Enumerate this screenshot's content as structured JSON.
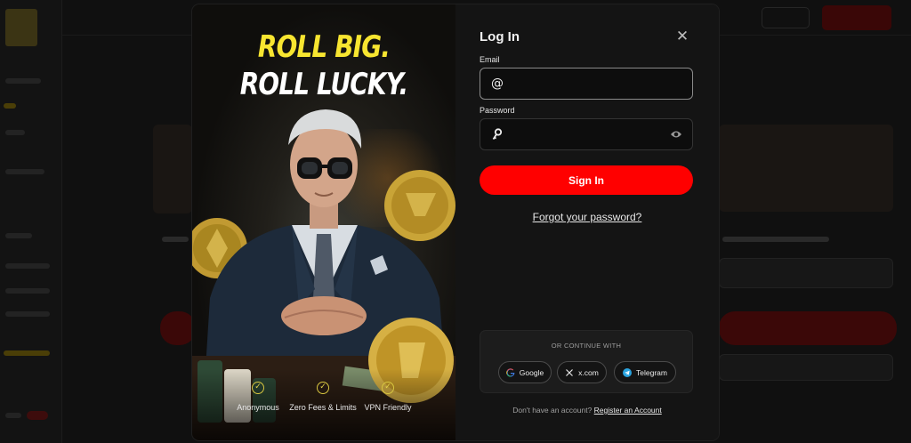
{
  "hero": {
    "headline_1": "ROLL BIG.",
    "headline_2": "ROLL LUCKY.",
    "perks": [
      {
        "label": "Anonymous"
      },
      {
        "label": "Zero Fees & Limits"
      },
      {
        "label": "VPN Friendly"
      }
    ],
    "colors": {
      "headline_accent": "#f7e530",
      "check": "#e4d34a"
    }
  },
  "login": {
    "title": "Log In",
    "email_label": "Email",
    "email_value": "",
    "password_label": "Password",
    "password_value": "",
    "signin_label": "Sign In",
    "forgot_label": "Forgot your password?",
    "oauth_heading": "OR CONTINUE WITH",
    "oauth": [
      {
        "label": "Google",
        "icon": "google-icon"
      },
      {
        "label": "x.com",
        "icon": "x-icon"
      },
      {
        "label": "Telegram",
        "icon": "telegram-icon"
      }
    ],
    "register_prompt": "Don't have an account?",
    "register_link": "Register an Account"
  },
  "icons": {
    "close": "close-icon",
    "email": "at-icon",
    "password": "key-icon",
    "reveal": "eye-icon",
    "check": "check-icon"
  },
  "colors": {
    "accent_red": "#ff0000",
    "panel_bg": "#141414",
    "input_bg": "#0d0d0d"
  }
}
